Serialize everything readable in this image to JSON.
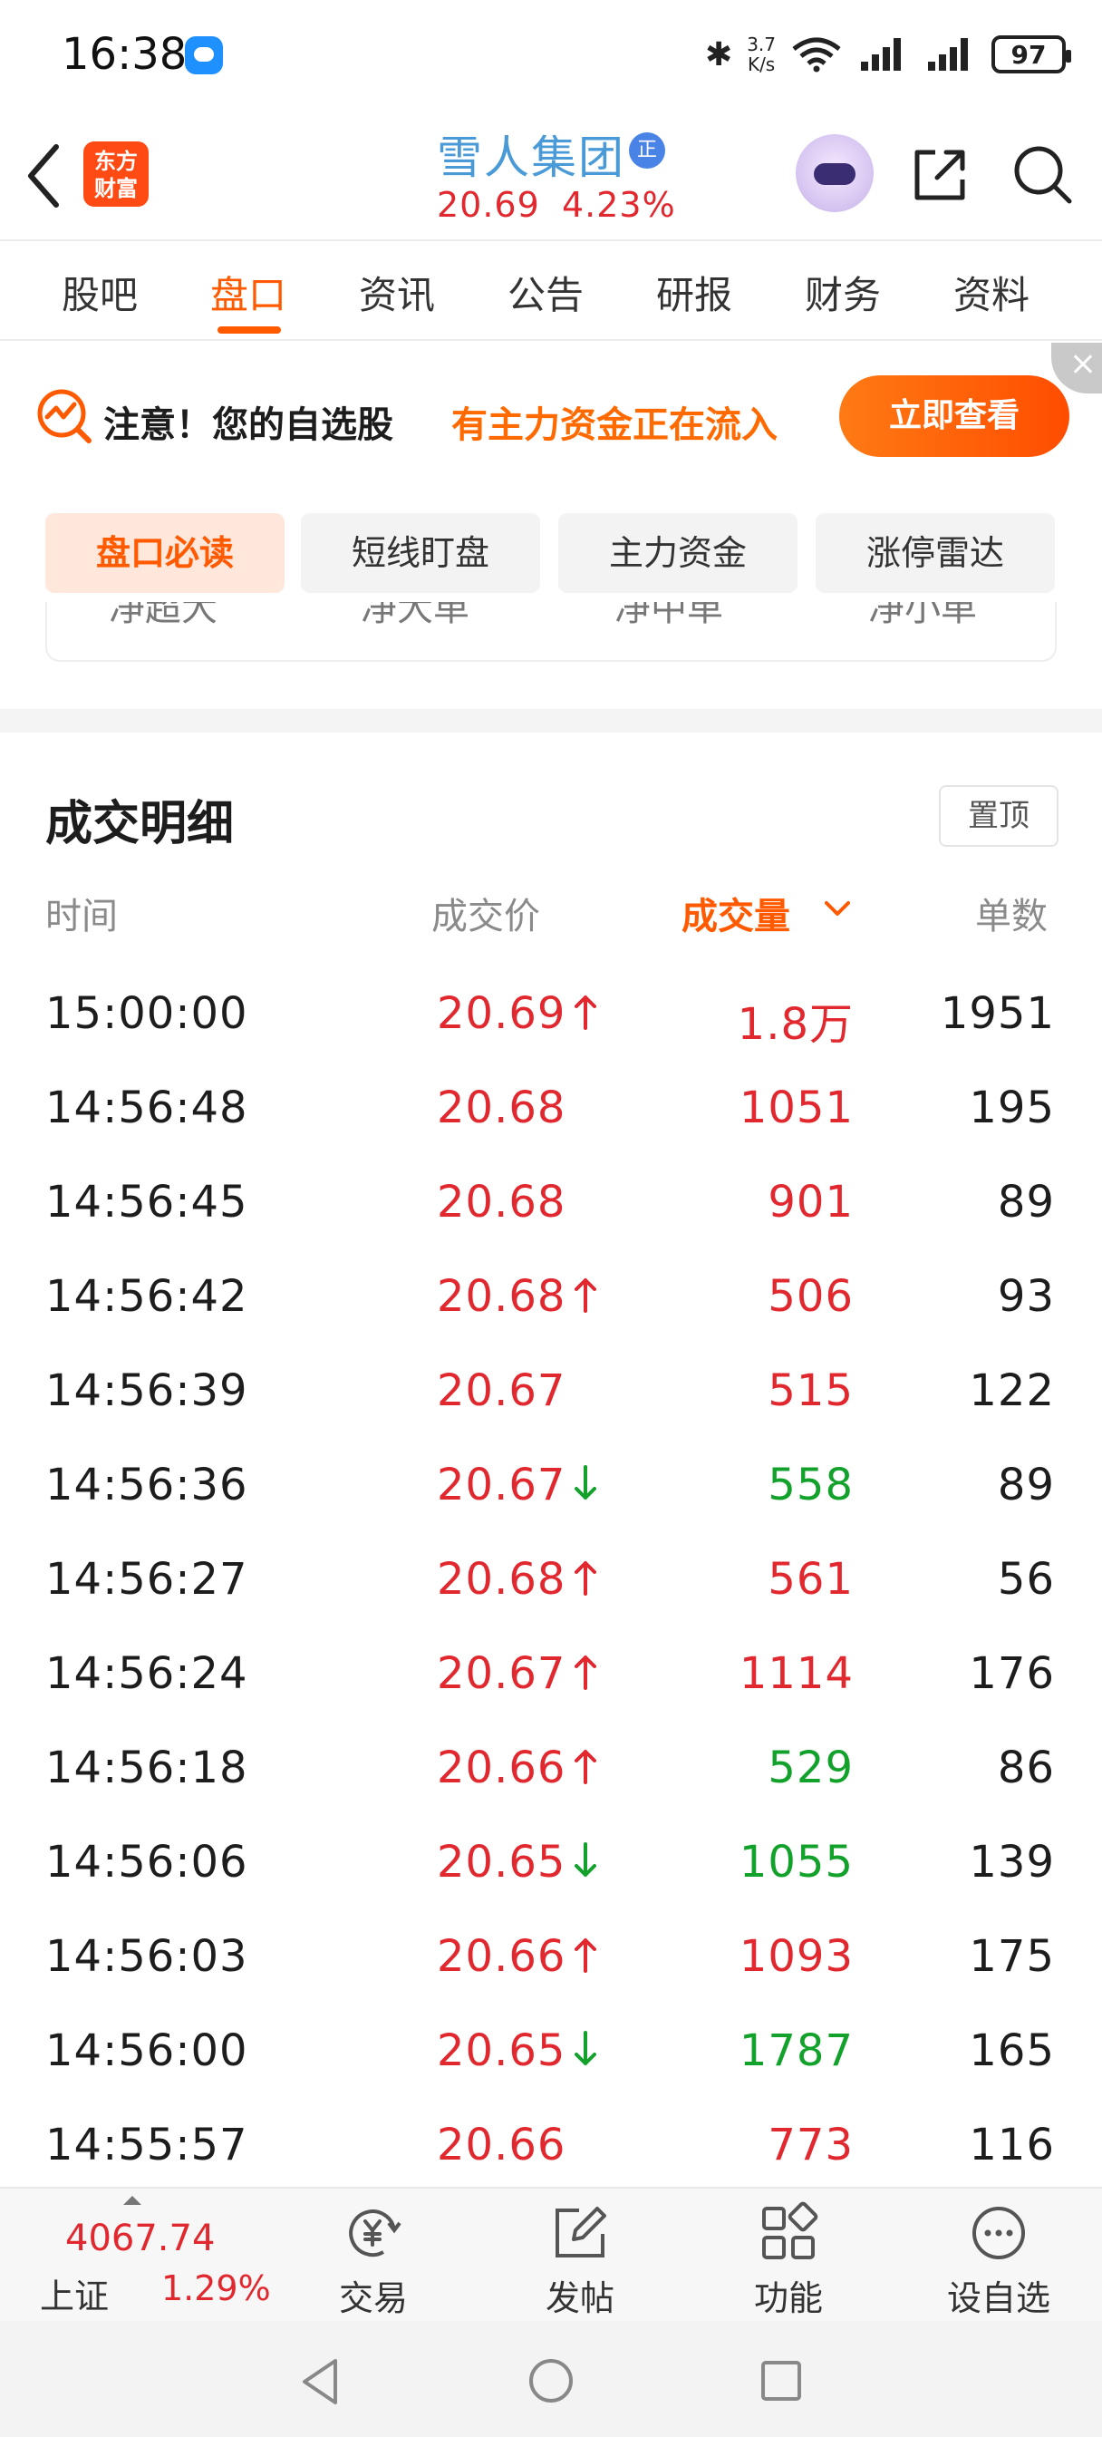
{
  "status_bar": {
    "time": "16:38",
    "net_speed_value": "3.7",
    "net_speed_unit": "K/s",
    "battery": "97"
  },
  "header": {
    "logo_line1": "东方",
    "logo_line2": "财富",
    "stock_name": "雪人集团",
    "badge": "正",
    "price": "20.69",
    "change_pct": "4.23%"
  },
  "tabs": [
    "股吧",
    "盘口",
    "资讯",
    "公告",
    "研报",
    "财务",
    "资料"
  ],
  "active_tab": "盘口",
  "banner": {
    "notice": "注意！您的自选股",
    "highlight": "有主力资金正在流入",
    "button": "立即查看"
  },
  "pills": [
    "盘口必读",
    "短线盯盘",
    "主力资金",
    "涨停雷达"
  ],
  "peek_items": [
    "净超大",
    "净大单",
    "净中单",
    "净小单"
  ],
  "trade_detail": {
    "title": "成交明细",
    "pin_button": "置顶",
    "columns": {
      "time": "时间",
      "price": "成交价",
      "volume": "成交量",
      "count": "单数"
    },
    "rows": [
      {
        "time": "15:00:00",
        "price": "20.69",
        "arrow": "up",
        "volume": "1.8万",
        "volume_color": "red",
        "count": "1951"
      },
      {
        "time": "14:56:48",
        "price": "20.68",
        "arrow": "",
        "volume": "1051",
        "volume_color": "red",
        "count": "195"
      },
      {
        "time": "14:56:45",
        "price": "20.68",
        "arrow": "",
        "volume": "901",
        "volume_color": "red",
        "count": "89"
      },
      {
        "time": "14:56:42",
        "price": "20.68",
        "arrow": "up",
        "volume": "506",
        "volume_color": "red",
        "count": "93"
      },
      {
        "time": "14:56:39",
        "price": "20.67",
        "arrow": "",
        "volume": "515",
        "volume_color": "red",
        "count": "122"
      },
      {
        "time": "14:56:36",
        "price": "20.67",
        "arrow": "down",
        "volume": "558",
        "volume_color": "green",
        "count": "89"
      },
      {
        "time": "14:56:27",
        "price": "20.68",
        "arrow": "up",
        "volume": "561",
        "volume_color": "red",
        "count": "56"
      },
      {
        "time": "14:56:24",
        "price": "20.67",
        "arrow": "up",
        "volume": "1114",
        "volume_color": "red",
        "count": "176"
      },
      {
        "time": "14:56:18",
        "price": "20.66",
        "arrow": "up",
        "volume": "529",
        "volume_color": "green",
        "count": "86"
      },
      {
        "time": "14:56:06",
        "price": "20.65",
        "arrow": "down",
        "volume": "1055",
        "volume_color": "green",
        "count": "139"
      },
      {
        "time": "14:56:03",
        "price": "20.66",
        "arrow": "up",
        "volume": "1093",
        "volume_color": "red",
        "count": "175"
      },
      {
        "time": "14:56:00",
        "price": "20.65",
        "arrow": "down",
        "volume": "1787",
        "volume_color": "green",
        "count": "165"
      },
      {
        "time": "14:55:57",
        "price": "20.66",
        "arrow": "",
        "volume": "773",
        "volume_color": "red",
        "count": "116"
      }
    ]
  },
  "bottom_bar": {
    "index_value": "4067.74",
    "index_name": "上证",
    "index_pct": "1.29%",
    "items": [
      {
        "label": "交易",
        "icon": "trade-yuan-icon"
      },
      {
        "label": "发帖",
        "icon": "compose-icon"
      },
      {
        "label": "功能",
        "icon": "grid-apps-icon"
      },
      {
        "label": "设自选",
        "icon": "more-dots-icon"
      }
    ]
  },
  "colors": {
    "up": "#e1282f",
    "down": "#12a22b",
    "accent": "#ff5a00",
    "stock_name": "#4a9ad8"
  }
}
